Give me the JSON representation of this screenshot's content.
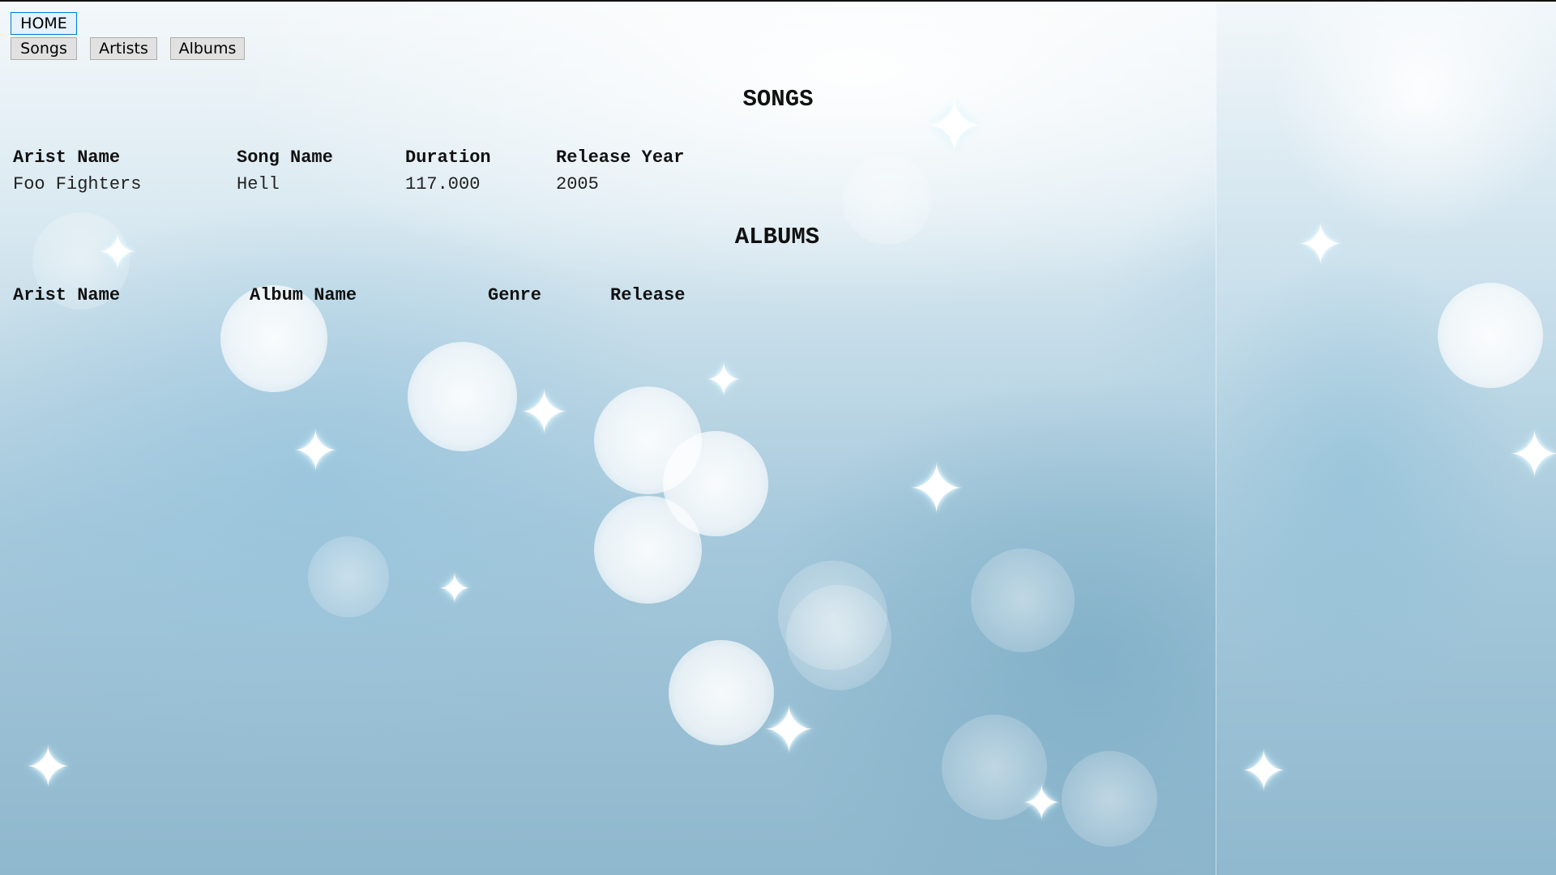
{
  "nav": {
    "home_label": "HOME",
    "songs_label": "Songs",
    "artists_label": "Artists",
    "albums_label": "Albums"
  },
  "songs": {
    "title": "SONGS",
    "headers": [
      "Arist Name",
      "Song Name",
      "Duration",
      "Release Year"
    ],
    "rows": [
      [
        "Foo Fighters",
        "Hell",
        "117.000",
        "2005"
      ]
    ]
  },
  "albums": {
    "title": "ALBUMS",
    "headers": [
      "Arist Name",
      "Album Name",
      "Genre",
      "Release"
    ],
    "rows": []
  },
  "colors": {
    "home_border": "#0078d7",
    "button_bg": "#e1e1e1",
    "text": "#111111"
  }
}
